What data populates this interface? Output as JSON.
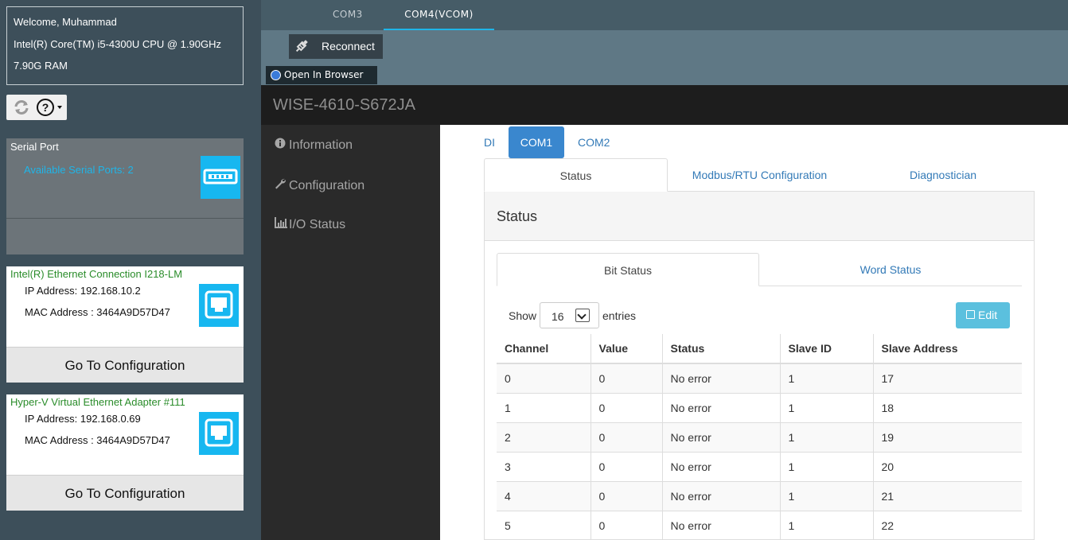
{
  "system": {
    "welcome": "Welcome, Muhammad",
    "cpu": "Intel(R) Core(TM) i5-4300U CPU @ 1.90GHz",
    "ram": "7.90G RAM"
  },
  "help_glyph": "?",
  "serial": {
    "title": "Serial Port",
    "available": "Available Serial Ports: 2"
  },
  "adapters": [
    {
      "name": "Intel(R) Ethernet Connection I218-LM",
      "ip": "IP Address: 192.168.10.2",
      "mac": "MAC Address : 3464A9D57D47",
      "goto": "Go To Configuration"
    },
    {
      "name": "Hyper-V Virtual Ethernet Adapter #111",
      "ip": "IP Address: 192.168.0.69",
      "mac": "MAC Address : 3464A9D57D47",
      "goto": "Go To Configuration"
    }
  ],
  "port_tabs": [
    "COM3",
    "COM4(VCOM)"
  ],
  "active_port_tab": "COM4(VCOM)",
  "reconnect_label": "Reconnect",
  "open_browser_label": "Open In Browser",
  "device_name": "WISE-4610-S672JA",
  "menu": [
    {
      "icon": "info-icon",
      "label": "Information"
    },
    {
      "icon": "wrench-icon",
      "label": "Configuration"
    },
    {
      "icon": "bar-chart-icon",
      "label": "I/O Status"
    }
  ],
  "com_tabs": [
    "DI",
    "COM1",
    "COM2"
  ],
  "active_com_tab": "COM1",
  "sub_tabs": [
    "Status",
    "Modbus/RTU Configuration",
    "Diagnostician"
  ],
  "active_sub_tab": "Status",
  "panel_title": "Status",
  "bit_word_tabs": [
    "Bit Status",
    "Word Status"
  ],
  "active_bit_word_tab": "Bit Status",
  "show_label": "Show",
  "entries_value": "16",
  "entries_label": "entries",
  "edit_label": "Edit",
  "table": {
    "headers": [
      "Channel",
      "Value",
      "Status",
      "Slave ID",
      "Slave Address"
    ],
    "rows": [
      [
        "0",
        "0",
        "No error",
        "1",
        "17"
      ],
      [
        "1",
        "0",
        "No error",
        "1",
        "18"
      ],
      [
        "2",
        "0",
        "No error",
        "1",
        "19"
      ],
      [
        "3",
        "0",
        "No error",
        "1",
        "20"
      ],
      [
        "4",
        "0",
        "No error",
        "1",
        "21"
      ],
      [
        "5",
        "0",
        "No error",
        "1",
        "22"
      ]
    ]
  },
  "colors": {
    "accent": "#1fb5e8",
    "active_com": "#3a87ce",
    "edit_button": "#5bc0de",
    "adapter_name": "#2a8c2a"
  }
}
